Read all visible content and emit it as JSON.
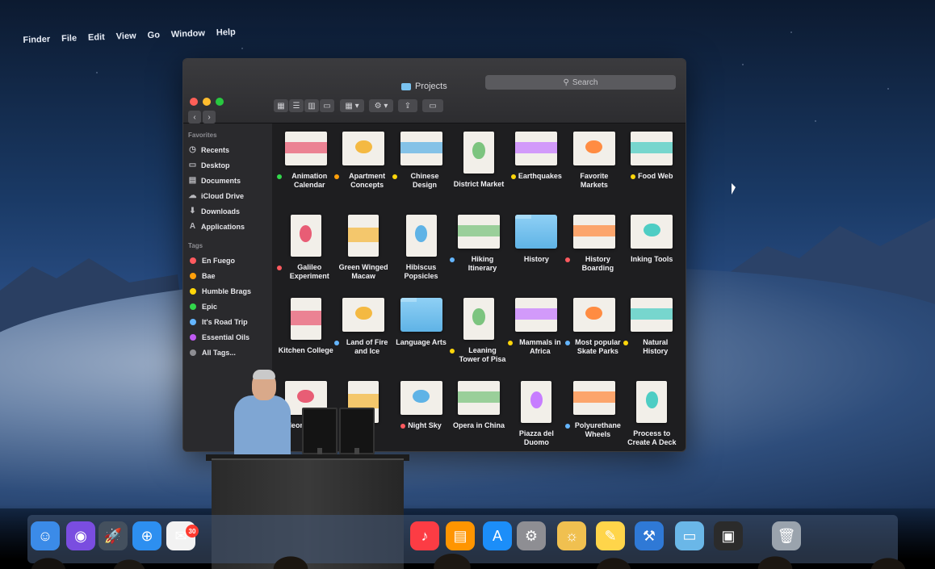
{
  "menubar": [
    "Finder",
    "File",
    "Edit",
    "View",
    "Go",
    "Window",
    "Help"
  ],
  "window": {
    "title": "Projects",
    "search_placeholder": "Search"
  },
  "sidebar": {
    "favorites_heading": "Favorites",
    "favorites": [
      {
        "label": "Recents",
        "icon": "clock-icon"
      },
      {
        "label": "Desktop",
        "icon": "desktop-icon"
      },
      {
        "label": "Documents",
        "icon": "document-icon"
      },
      {
        "label": "iCloud Drive",
        "icon": "cloud-icon"
      },
      {
        "label": "Downloads",
        "icon": "download-icon"
      },
      {
        "label": "Applications",
        "icon": "applications-icon"
      }
    ],
    "tags_heading": "Tags",
    "tags": [
      {
        "label": "En Fuego",
        "color": "#ff5a5f"
      },
      {
        "label": "Bae",
        "color": "#ff9f0a"
      },
      {
        "label": "Humble Brags",
        "color": "#ffd60a"
      },
      {
        "label": "Epic",
        "color": "#32d74b"
      },
      {
        "label": "It's Road Trip",
        "color": "#64b5ff"
      },
      {
        "label": "Essential Oils",
        "color": "#bf5af2"
      },
      {
        "label": "All Tags...",
        "color": "#8e8e93"
      }
    ]
  },
  "files": [
    {
      "name": "Animation Calendar",
      "tag": "#32d74b",
      "kind": "doc"
    },
    {
      "name": "Apartment Concepts",
      "tag": "#ff9f0a",
      "kind": "doc"
    },
    {
      "name": "Chinese Design",
      "tag": "#ffd60a",
      "kind": "doc"
    },
    {
      "name": "District Market",
      "tag": "",
      "kind": "portrait"
    },
    {
      "name": "Earthquakes",
      "tag": "#ffd60a",
      "kind": "doc"
    },
    {
      "name": "Favorite Markets",
      "tag": "",
      "kind": "doc"
    },
    {
      "name": "Food Web",
      "tag": "#ffd60a",
      "kind": "doc"
    },
    {
      "name": "Galileo Experiment",
      "tag": "#ff5a5f",
      "kind": "portrait"
    },
    {
      "name": "Green Winged Macaw",
      "tag": "",
      "kind": "portrait"
    },
    {
      "name": "Hibiscus Popsicles",
      "tag": "",
      "kind": "portrait"
    },
    {
      "name": "Hiking Itinerary",
      "tag": "#64b5ff",
      "kind": "doc"
    },
    {
      "name": "History",
      "tag": "",
      "kind": "folder"
    },
    {
      "name": "History Boarding",
      "tag": "#ff5a5f",
      "kind": "doc"
    },
    {
      "name": "Inking Tools",
      "tag": "",
      "kind": "doc"
    },
    {
      "name": "Kitchen College",
      "tag": "",
      "kind": "portrait"
    },
    {
      "name": "Land of Fire and Ice",
      "tag": "#64b5ff",
      "kind": "doc"
    },
    {
      "name": "Language Arts",
      "tag": "",
      "kind": "folder"
    },
    {
      "name": "Leaning Tower of Pisa",
      "tag": "#ffd60a",
      "kind": "portrait"
    },
    {
      "name": "Mammals in Africa",
      "tag": "#ffd60a",
      "kind": "doc"
    },
    {
      "name": "Most popular Skate Parks",
      "tag": "#64b5ff",
      "kind": "doc"
    },
    {
      "name": "Natural History",
      "tag": "#ffd60a",
      "kind": "doc"
    },
    {
      "name": "Neon Skies",
      "tag": "",
      "kind": "doc"
    },
    {
      "name": "",
      "tag": "",
      "kind": "portrait"
    },
    {
      "name": "Night Sky",
      "tag": "#ff5a5f",
      "kind": "doc"
    },
    {
      "name": "Opera in China",
      "tag": "",
      "kind": "doc"
    },
    {
      "name": "Piazza del Duomo",
      "tag": "",
      "kind": "portrait"
    },
    {
      "name": "Polyurethane Wheels",
      "tag": "#64b5ff",
      "kind": "doc"
    },
    {
      "name": "Process to Create A Deck",
      "tag": "",
      "kind": "portrait"
    }
  ],
  "dock": {
    "mail_badge": "30",
    "apps": [
      "finder-icon",
      "siri-icon",
      "launchpad-icon",
      "safari-icon",
      "mail-icon",
      "music-icon",
      "books-icon",
      "appstore-icon",
      "settings-icon",
      "lamp-icon",
      "notes-icon",
      "xcode-icon",
      "folder-icon",
      "screen-icon",
      "trash-icon"
    ]
  }
}
